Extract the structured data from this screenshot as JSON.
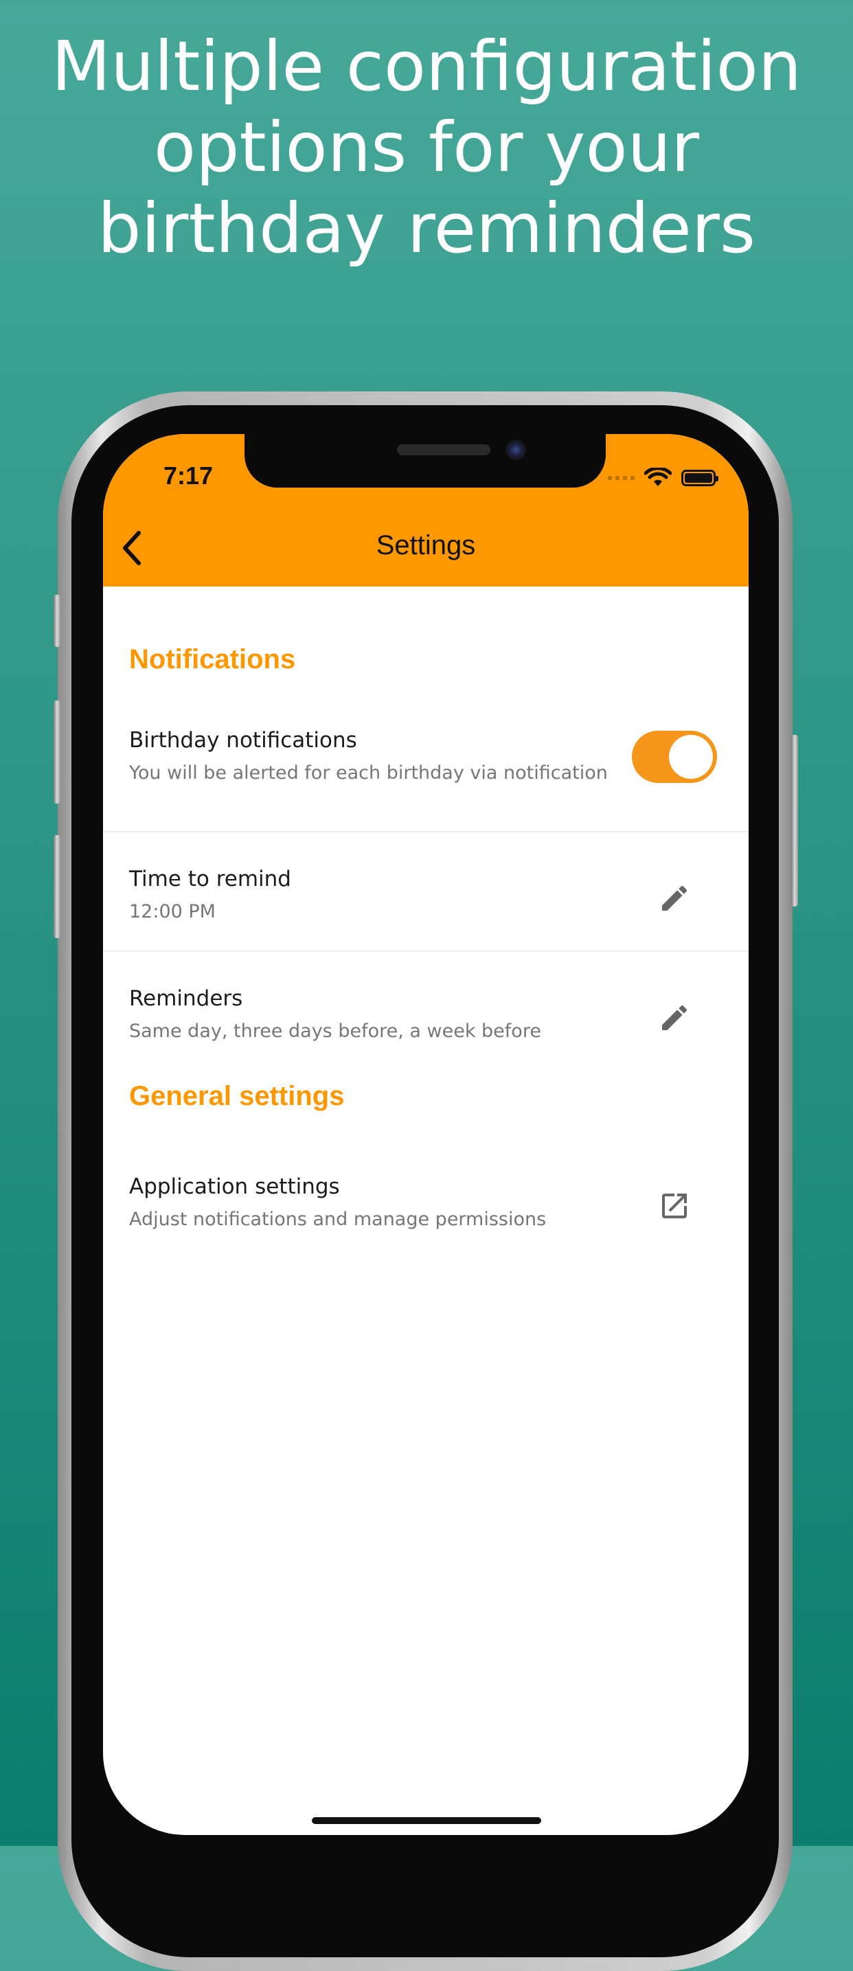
{
  "headline": {
    "line1": "Multiple configuration",
    "line2": "options for your",
    "line3": "birthday reminders"
  },
  "status_bar": {
    "time": "7:17",
    "icons": [
      "cellular-dots-icon",
      "wifi-icon",
      "battery-icon"
    ]
  },
  "app_bar": {
    "back_icon": "chevron-left-icon",
    "title": "Settings",
    "background": "#ff9800"
  },
  "sections": {
    "notifications": {
      "header": "Notifications",
      "birthday_notifications": {
        "title": "Birthday notifications",
        "subtitle": "You will be alerted for each birthday via notification",
        "toggle_on": true
      },
      "time_to_remind": {
        "title": "Time to remind",
        "subtitle": "12:00 PM",
        "icon": "pencil-icon"
      },
      "reminders": {
        "title": "Reminders",
        "subtitle": "Same day, three days before, a week before",
        "icon": "pencil-icon"
      }
    },
    "general": {
      "header": "General settings",
      "application_settings": {
        "title": "Application settings",
        "subtitle": "Adjust notifications and manage permissions",
        "icon": "open-external-icon"
      }
    }
  },
  "colors": {
    "accent": "#ff9800",
    "background_top": "#47a898",
    "background_bottom": "#0c7d6c"
  }
}
